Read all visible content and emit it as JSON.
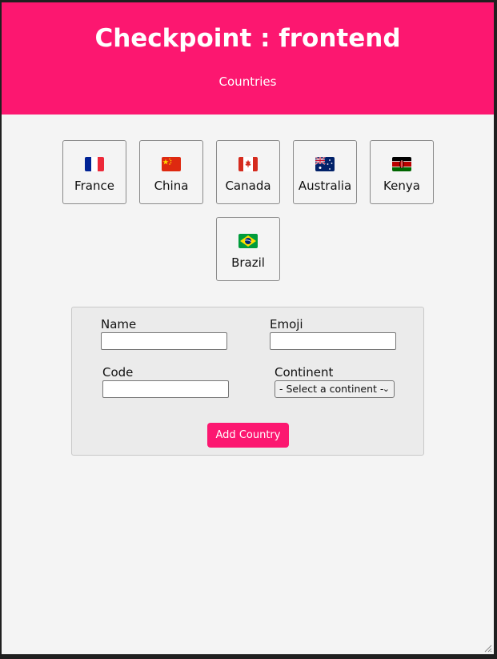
{
  "header": {
    "title": "Checkpoint : frontend",
    "subtitle": "Countries"
  },
  "countries": [
    {
      "name": "France",
      "flag_icon": "france-flag-icon"
    },
    {
      "name": "China",
      "flag_icon": "china-flag-icon"
    },
    {
      "name": "Canada",
      "flag_icon": "canada-flag-icon"
    },
    {
      "name": "Australia",
      "flag_icon": "australia-flag-icon"
    },
    {
      "name": "Kenya",
      "flag_icon": "kenya-flag-icon"
    },
    {
      "name": "Brazil",
      "flag_icon": "brazil-flag-icon"
    }
  ],
  "form": {
    "name_label": "Name",
    "name_value": "",
    "emoji_label": "Emoji",
    "emoji_value": "",
    "code_label": "Code",
    "code_value": "",
    "continent_label": "Continent",
    "continent_selected": "- Select a continent -",
    "submit_label": "Add Country"
  },
  "colors": {
    "accent": "#fc1770",
    "background": "#f4f4f4",
    "form_background": "#ebebeb"
  }
}
